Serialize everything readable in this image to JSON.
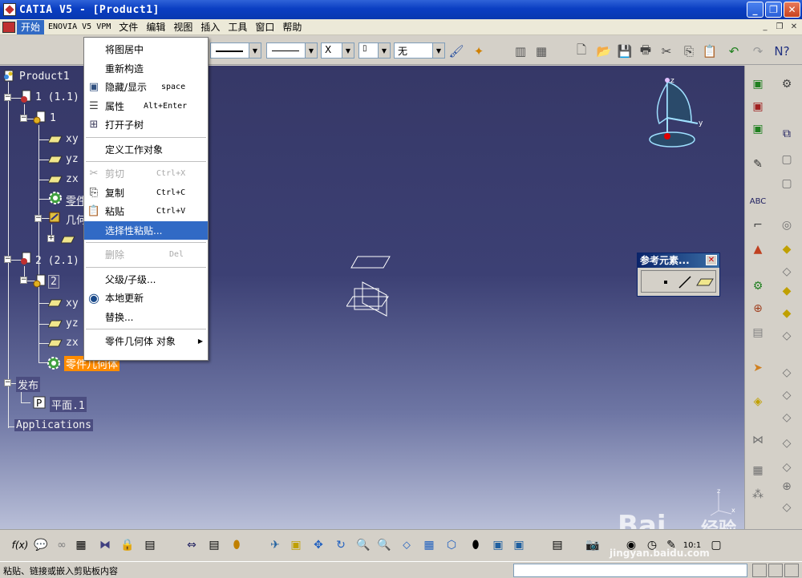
{
  "window": {
    "title": "CATIA V5 - [Product1]",
    "min": "_",
    "max": "❐",
    "close": "✕"
  },
  "menubar": {
    "items": [
      "开始",
      "ENOVIA V5 VPM",
      "文件",
      "编辑",
      "视图",
      "插入",
      "工具",
      "窗口",
      "帮助"
    ],
    "mdi": [
      "_",
      "❐",
      "✕"
    ]
  },
  "toolbar": {
    "combo_x": "X",
    "combo_none": "无"
  },
  "tree": {
    "root": "Product1",
    "n1": "1 (1.1)",
    "n1_part": "1",
    "xy": "xy",
    "yz": "yz",
    "zx": "zx",
    "partbody": "零件几",
    "geoset": "几何",
    "n2": "2 (2.1)",
    "n2_part": "2",
    "xy2": "xy",
    "yz2": "yz",
    "zx2": "zx",
    "partbody2": "零件几何体",
    "publish": "发布",
    "plane1": "平面.1",
    "applications": "Applications"
  },
  "context_menu": {
    "center": "将图居中",
    "reframe": "重新构造",
    "hide_show": "隐藏/显示",
    "hide_show_sc": "space",
    "properties": "属性",
    "properties_sc": "Alt+Enter",
    "open_subtree": "打开子树",
    "define_work_obj": "定义工作对象",
    "cut": "剪切",
    "cut_sc": "Ctrl+X",
    "copy": "复制",
    "copy_sc": "Ctrl+C",
    "paste": "粘贴",
    "paste_sc": "Ctrl+V",
    "paste_special": "选择性粘贴...",
    "delete": "删除",
    "delete_sc": "Del",
    "parents_children": "父级/子级...",
    "local_update": "本地更新",
    "replace": "替换...",
    "part_body_obj": "零件几何体 对象"
  },
  "ref_panel": {
    "title": "参考元素..."
  },
  "compass": {
    "z": "z",
    "y": "y"
  },
  "axes": {
    "z": "z",
    "x": "x"
  },
  "bottom": {
    "scale": "10:1"
  },
  "status": {
    "message": "粘贴、链接或嵌入剪贴板内容"
  },
  "watermark": {
    "brand": "Bai",
    "brand2": "经验",
    "url": "jingyan.baidu.com"
  }
}
